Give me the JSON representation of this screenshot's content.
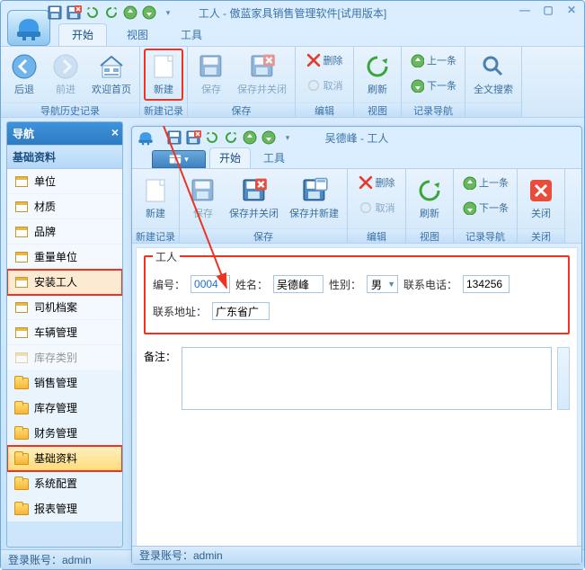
{
  "main": {
    "title": "工人 - 傲蓝家具销售管理软件[试用版本]",
    "qat": {
      "save": "save-icon",
      "saveclose": "saveclose-icon",
      "undo": "undo",
      "redo": "redo",
      "up": "up",
      "down": "down"
    },
    "tabs": {
      "start": "开始",
      "view": "视图",
      "tools": "工具"
    },
    "ribbon": {
      "back": "后退",
      "forward": "前进",
      "welcome": "欢迎首页",
      "g1": "导航历史记录",
      "new": "新建",
      "g2": "新建记录",
      "save": "保存",
      "saveclose": "保存并关闭",
      "g3": "保存",
      "delete": "删除",
      "cancel": "取消",
      "g4": "编辑",
      "refresh": "刷新",
      "g5": "视图",
      "prev": "上一条",
      "next": "下一条",
      "g6": "记录导航",
      "search": "全文搜索"
    },
    "nav": {
      "title": "导航",
      "group": "基础资料",
      "items": [
        "单位",
        "材质",
        "品牌",
        "重量单位",
        "安装工人",
        "司机档案",
        "车辆管理",
        "库存类别"
      ],
      "folders": [
        "销售管理",
        "库存管理",
        "财务管理",
        "基础资料",
        "系统配置",
        "报表管理"
      ]
    },
    "status": "登录账号：admin"
  },
  "child": {
    "title": "吴德峰 - 工人",
    "tabs": {
      "start": "开始",
      "tools": "工具"
    },
    "ribbon": {
      "new": "新建",
      "g1": "新建记录",
      "save": "保存",
      "saveclose": "保存并关闭",
      "savenew": "保存并新建",
      "g2": "保存",
      "delete": "删除",
      "cancel": "取消",
      "g3": "编辑",
      "refresh": "刷新",
      "g4": "视图",
      "prev": "上一条",
      "next": "下一条",
      "g5": "记录导航",
      "close": "关闭",
      "g6": "关闭"
    },
    "form": {
      "legend": "工人",
      "no_label": "编号：",
      "no": "0004",
      "name_label": "姓名：",
      "name": "吴德峰",
      "sex_label": "性别：",
      "sex": "男",
      "tel_label": "联系电话：",
      "tel": "134256",
      "addr_label": "联系地址：",
      "addr": "广东省广",
      "remark_label": "备注：",
      "remark": ""
    },
    "status": "登录账号：admin"
  }
}
